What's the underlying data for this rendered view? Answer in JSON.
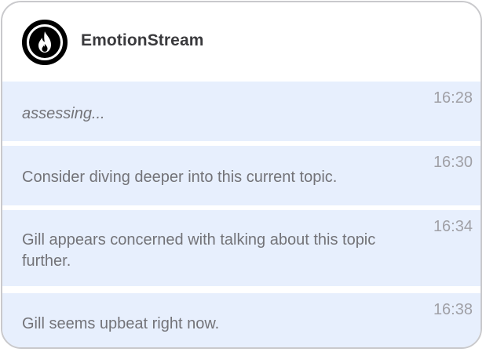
{
  "app": {
    "title": "EmotionStream",
    "logo_icon": "flame-icon"
  },
  "colors": {
    "item_background": "#e7effd",
    "border": "#c9c9cc",
    "text": "#737378",
    "timestamp": "#a0a0a6",
    "title": "#3a3a3d"
  },
  "feed": {
    "items": [
      {
        "text": "assessing...",
        "time": "16:28",
        "style": "italic"
      },
      {
        "text": "Consider diving deeper into this current topic.",
        "time": "16:30"
      },
      {
        "text": "Gill appears concerned with talking about this topic further.",
        "time": "16:34"
      },
      {
        "text": "Gill seems upbeat right now.",
        "time": "16:38"
      }
    ]
  }
}
